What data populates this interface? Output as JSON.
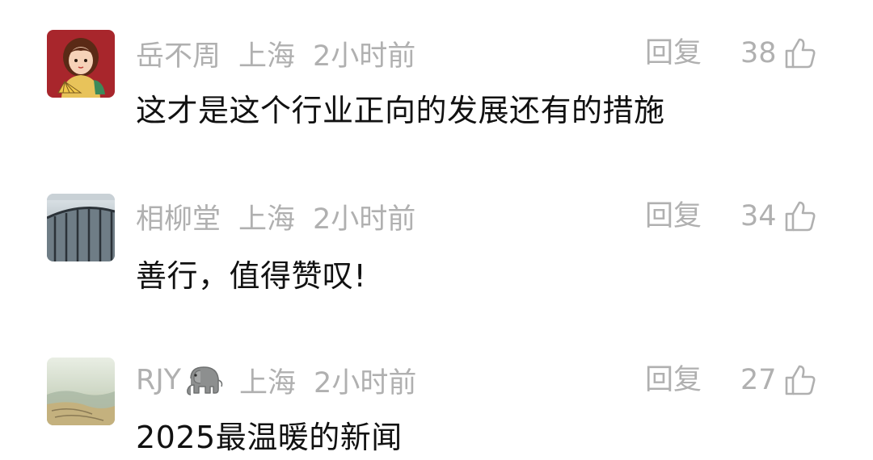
{
  "comments": [
    {
      "username": "岳不周",
      "location": "上海",
      "time": "2小时前",
      "reply_label": "回复",
      "likes": "38",
      "text": "这才是这个行业正向的发展还有的措施",
      "avatar": "illustrated-woman-with-fan"
    },
    {
      "username": "相柳堂",
      "location": "上海",
      "time": "2小时前",
      "reply_label": "回复",
      "likes": "34",
      "text": "善行，值得赞叹!",
      "avatar": "architecture-photo"
    },
    {
      "username": "RJY",
      "location": "上海",
      "time": "2小时前",
      "reply_label": "回复",
      "likes": "27",
      "text": "2025最温暖的新闻",
      "avatar": "landscape-painting",
      "name_emoji": "elephant"
    }
  ],
  "colors": {
    "meta": "#b0b0b0",
    "text": "#111111",
    "avatar1_bg": "#a8262c"
  }
}
